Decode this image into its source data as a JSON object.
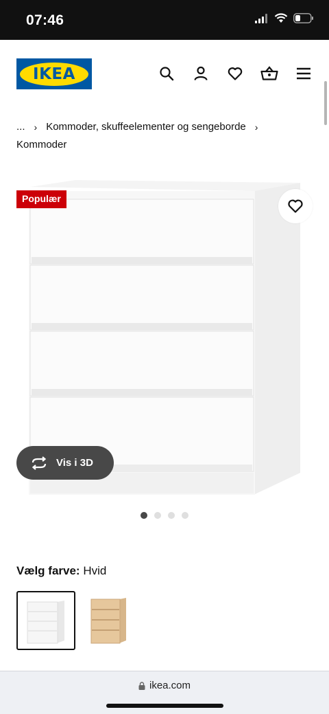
{
  "status_bar": {
    "time": "07:46"
  },
  "header": {
    "logo_text": "IKEA",
    "icons": [
      "search-icon",
      "account-icon",
      "favourites-icon",
      "basket-icon",
      "menu-icon"
    ]
  },
  "breadcrumb": {
    "ellipsis": "...",
    "items": [
      "Kommoder, skuffeelementer og sengeborde",
      "Kommoder"
    ]
  },
  "product": {
    "badge": "Populær",
    "view_3d_label": "Vis i 3D",
    "image_count": 4,
    "active_image": 0
  },
  "color": {
    "label": "Vælg farve:",
    "selected_value": "Hvid",
    "swatches": [
      "Hvid",
      "Hvidbejdset egetræsfinér"
    ]
  },
  "browser": {
    "url": "ikea.com"
  },
  "colors": {
    "ikea_blue": "#0058a3",
    "ikea_yellow": "#ffdb00",
    "badge_red": "#cc0008",
    "dark_button": "#484848"
  }
}
